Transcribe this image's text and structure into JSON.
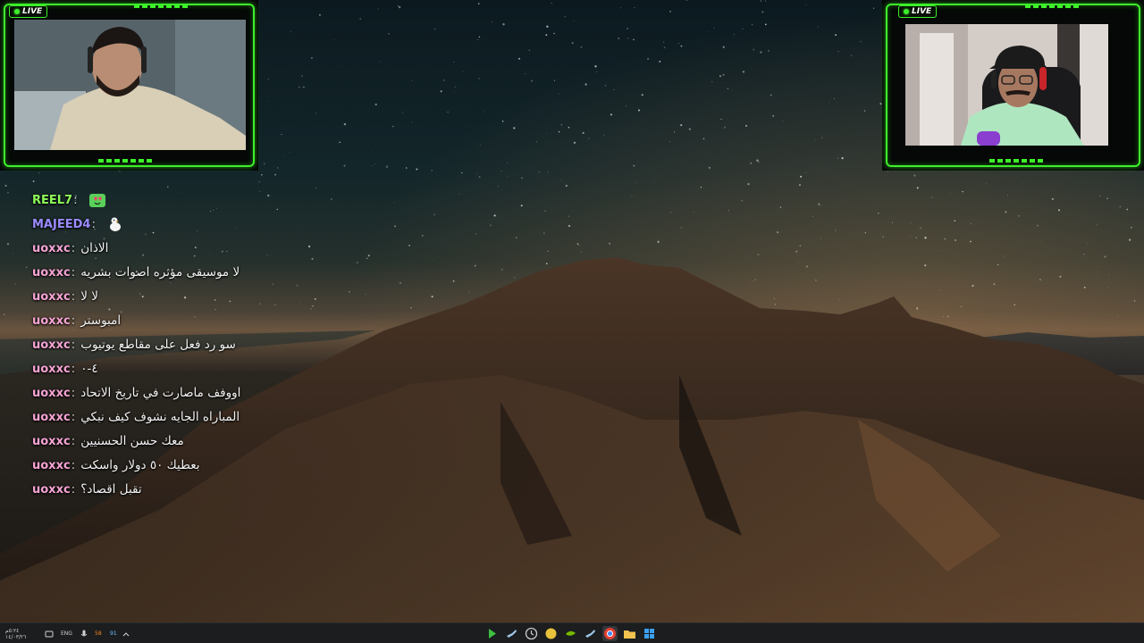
{
  "left_cam": {
    "live_label": "LIVE"
  },
  "right_cam": {
    "live_label": "LIVE"
  },
  "chat": {
    "messages": [
      {
        "user": "REEL7",
        "user_color": "#8dfc5a",
        "text": "",
        "emote": "heart-eyes-emote"
      },
      {
        "user": "MAJEED4",
        "user_color": "#9a8cff",
        "text": "",
        "emote": "duck-emote"
      },
      {
        "user": "uoxxc",
        "user_color": "#f5a3d4",
        "text": "الاذان",
        "emote": ""
      },
      {
        "user": "uoxxc",
        "user_color": "#f5a3d4",
        "text": "لا موسيقى مؤثره اصوات بشريه",
        "emote": ""
      },
      {
        "user": "uoxxc",
        "user_color": "#f5a3d4",
        "text": "لا لا",
        "emote": ""
      },
      {
        "user": "uoxxc",
        "user_color": "#f5a3d4",
        "text": "امبوستر",
        "emote": ""
      },
      {
        "user": "uoxxc",
        "user_color": "#f5a3d4",
        "text": "سو رد فعل على مقاطع يوتيوب",
        "emote": ""
      },
      {
        "user": "uoxxc",
        "user_color": "#f5a3d4",
        "text": "٤-٠",
        "emote": ""
      },
      {
        "user": "uoxxc",
        "user_color": "#f5a3d4",
        "text": "اووفف ماصارت في تاريخ الاتحاد",
        "emote": ""
      },
      {
        "user": "uoxxc",
        "user_color": "#f5a3d4",
        "text": "المباراه الجايه نشوف كيف نبكي",
        "emote": ""
      },
      {
        "user": "uoxxc",
        "user_color": "#f5a3d4",
        "text": "معك حسن الحسنيين",
        "emote": ""
      },
      {
        "user": "uoxxc",
        "user_color": "#f5a3d4",
        "text": "بعطيك ٥٠ دولار واسكت",
        "emote": ""
      },
      {
        "user": "uoxxc",
        "user_color": "#f5a3d4",
        "text": "تقبل اقصاد؟",
        "emote": ""
      }
    ]
  },
  "taskbar": {
    "clock_time": "٥:٢٤م",
    "clock_date": "١٤/٠٣/٢٦",
    "language": "ENG",
    "tray_values": [
      "58",
      "91"
    ],
    "apps": [
      {
        "name": "media-player-icon",
        "color": "#3fbf3f"
      },
      {
        "name": "steam-icon",
        "color": "#9fc6e6"
      },
      {
        "name": "clock-app-icon",
        "color": "#cccccc"
      },
      {
        "name": "notes-app-icon",
        "color": "#e8c23a"
      },
      {
        "name": "nvidia-icon",
        "color": "#76b900"
      },
      {
        "name": "steam-alt-icon",
        "color": "#9fc6e6"
      },
      {
        "name": "chrome-icon",
        "color": "#e34133"
      },
      {
        "name": "file-explorer-icon",
        "color": "#f2c14e"
      },
      {
        "name": "windows-store-icon",
        "color": "#3aa0f2"
      }
    ]
  }
}
